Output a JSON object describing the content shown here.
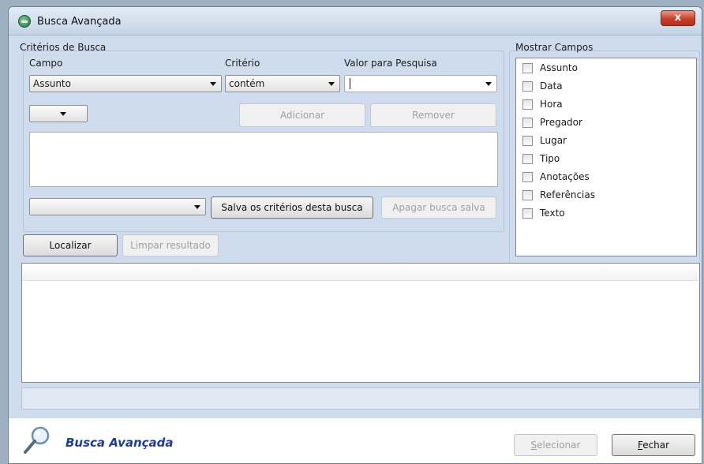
{
  "window": {
    "title": "Busca Avançada",
    "close_label": "x"
  },
  "criteria": {
    "group_title": "Critérios de Busca",
    "campo_label": "Campo",
    "criterio_label": "Critério",
    "valor_label": "Valor para Pesquisa",
    "campo_value": "Assunto",
    "criterio_value": "contém",
    "valor_value": "",
    "connector_value": "",
    "adicionar_label": "Adicionar",
    "remover_label": "Remover",
    "saved_search_value": "",
    "salva_label": "Salva os critérios desta busca",
    "apagar_label": "Apagar busca salva"
  },
  "actions": {
    "localizar_label": "Localizar",
    "limpar_label": "Limpar resultado"
  },
  "mostrar_campos": {
    "group_title": "Mostrar Campos",
    "items": [
      {
        "label": "Assunto",
        "checked": false
      },
      {
        "label": "Data",
        "checked": false
      },
      {
        "label": "Hora",
        "checked": false
      },
      {
        "label": "Pregador",
        "checked": false
      },
      {
        "label": "Lugar",
        "checked": false
      },
      {
        "label": "Tipo",
        "checked": false
      },
      {
        "label": "Anotações",
        "checked": false
      },
      {
        "label": "Referências",
        "checked": false
      },
      {
        "label": "Texto",
        "checked": false
      }
    ]
  },
  "footer": {
    "title": "Busca Avançada",
    "selecionar_accesskey": "S",
    "selecionar_rest": "elecionar",
    "fechar_accesskey": "F",
    "fechar_rest": "echar"
  }
}
